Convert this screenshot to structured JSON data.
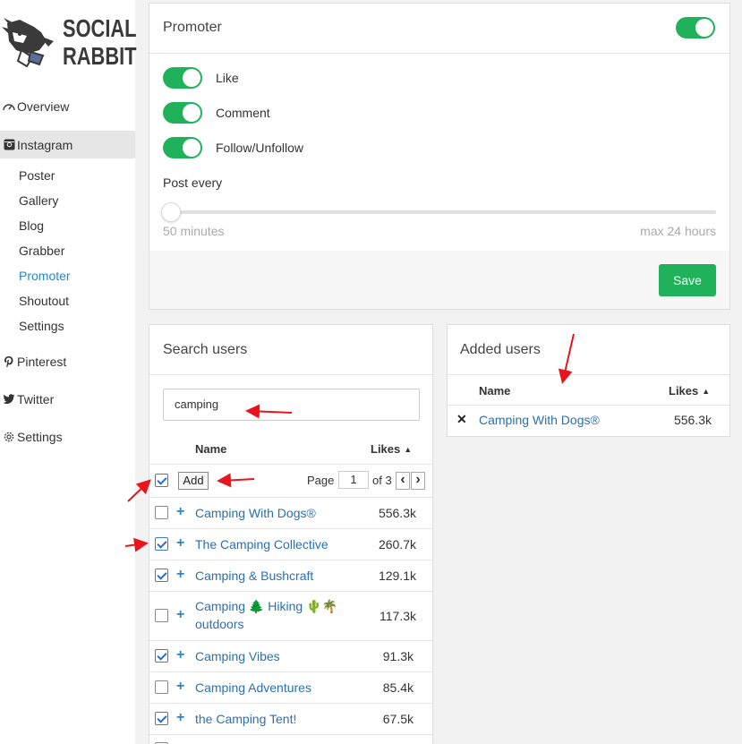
{
  "brand": {
    "line1": "SOCIAL",
    "line2": "RABBIT"
  },
  "sidebar": {
    "items": [
      {
        "label": "Overview",
        "icon": "dashboard-icon"
      },
      {
        "label": "Instagram",
        "icon": "instagram-icon"
      },
      {
        "label": "Pinterest",
        "icon": "pinterest-icon"
      },
      {
        "label": "Twitter",
        "icon": "twitter-icon"
      },
      {
        "label": "Settings",
        "icon": "gear-icon"
      }
    ],
    "sub_items": [
      "Poster",
      "Gallery",
      "Blog",
      "Grabber",
      "Promoter",
      "Shoutout",
      "Settings"
    ]
  },
  "promoter": {
    "title": "Promoter",
    "toggles": [
      "Like",
      "Comment",
      "Follow/Unfollow"
    ],
    "post_every_label": "Post every",
    "slider_min_label": "50 minutes",
    "slider_max_label": "max 24 hours",
    "slider_value_fraction": 0.0,
    "save_label": "Save"
  },
  "search": {
    "title": "Search users",
    "query": "camping",
    "col_name": "Name",
    "col_likes": "Likes",
    "sort_indicator": "▲",
    "add_label": "Add",
    "page_label": "Page",
    "page_value": "1",
    "page_of": "of 3",
    "prev": "‹",
    "next": "›",
    "rows": [
      {
        "name": "Camping With Dogs®",
        "likes": "556.3k",
        "checked": false
      },
      {
        "name": "The Camping Collective",
        "likes": "260.7k",
        "checked": true
      },
      {
        "name": "Camping & Bushcraft",
        "likes": "129.1k",
        "checked": true
      },
      {
        "name": "Camping 🌲 Hiking 🌵🌴",
        "name2": "outdoors",
        "likes": "117.3k",
        "checked": false
      },
      {
        "name": "Camping Vibes",
        "likes": "91.3k",
        "checked": true
      },
      {
        "name": "Camping Adventures",
        "likes": "85.4k",
        "checked": false
      },
      {
        "name": "the Camping Tent!",
        "likes": "67.5k",
        "checked": true
      }
    ]
  },
  "added": {
    "title": "Added users",
    "col_name": "Name",
    "col_likes": "Likes",
    "sort_indicator": "▲",
    "remove_glyph": "✕",
    "rows": [
      {
        "name": "Camping With Dogs®",
        "likes": "556.3k"
      }
    ]
  },
  "colors": {
    "accent_green": "#1fb25a",
    "link_blue": "#2a70b0",
    "annotation_red": "#e8161c"
  }
}
